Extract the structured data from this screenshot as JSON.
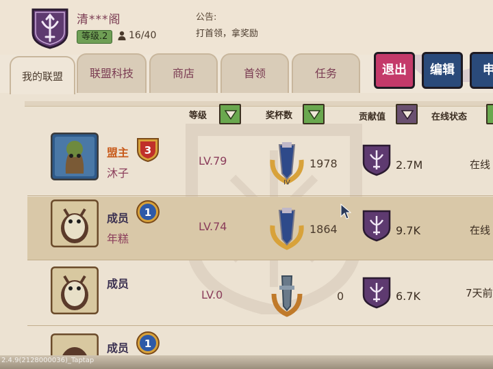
{
  "guild": {
    "name": "清***阁",
    "level": "等级.2",
    "members": "16/40",
    "notice_label": "公告:",
    "notice_text": "打首领，拿奖励"
  },
  "tabs": [
    {
      "label": "我的联盟",
      "active": true
    },
    {
      "label": "联盟科技"
    },
    {
      "label": "商店"
    },
    {
      "label": "首领"
    },
    {
      "label": "任务"
    }
  ],
  "actions": {
    "quit": "退出",
    "edit": "编辑",
    "apply": "申"
  },
  "columns": {
    "level": "等级",
    "trophies": "奖杯数",
    "contribution": "贡献值",
    "online": "在线状态"
  },
  "members": [
    {
      "role": "盟主",
      "rank": "3",
      "name": "沐子",
      "level": "LV.79",
      "trophies": "1978",
      "contribution": "2.7M",
      "status": "在线"
    },
    {
      "role": "成员",
      "rank": "1",
      "name": "年糕",
      "level": "LV.74",
      "trophies": "1864",
      "contribution": "9.7K",
      "status": "在线"
    },
    {
      "role": "成员",
      "rank": "",
      "name": "",
      "level": "LV.0",
      "trophies": "0",
      "contribution": "6.7K",
      "status": "7天前"
    },
    {
      "role": "成员",
      "rank": "1",
      "name": "",
      "level": "",
      "trophies": "",
      "contribution": "",
      "status": ""
    }
  ],
  "version_text": "2.4.9(2128000036)_Taptap",
  "colors": {
    "accent_purple": "#5e3a70",
    "role_leader": "#c85a1a",
    "role_member": "#3a3050",
    "quit_button": "#c43a6a",
    "edit_button": "#2a4a7a",
    "sort_green": "#6aa84f",
    "sort_purple": "#6a5070"
  }
}
